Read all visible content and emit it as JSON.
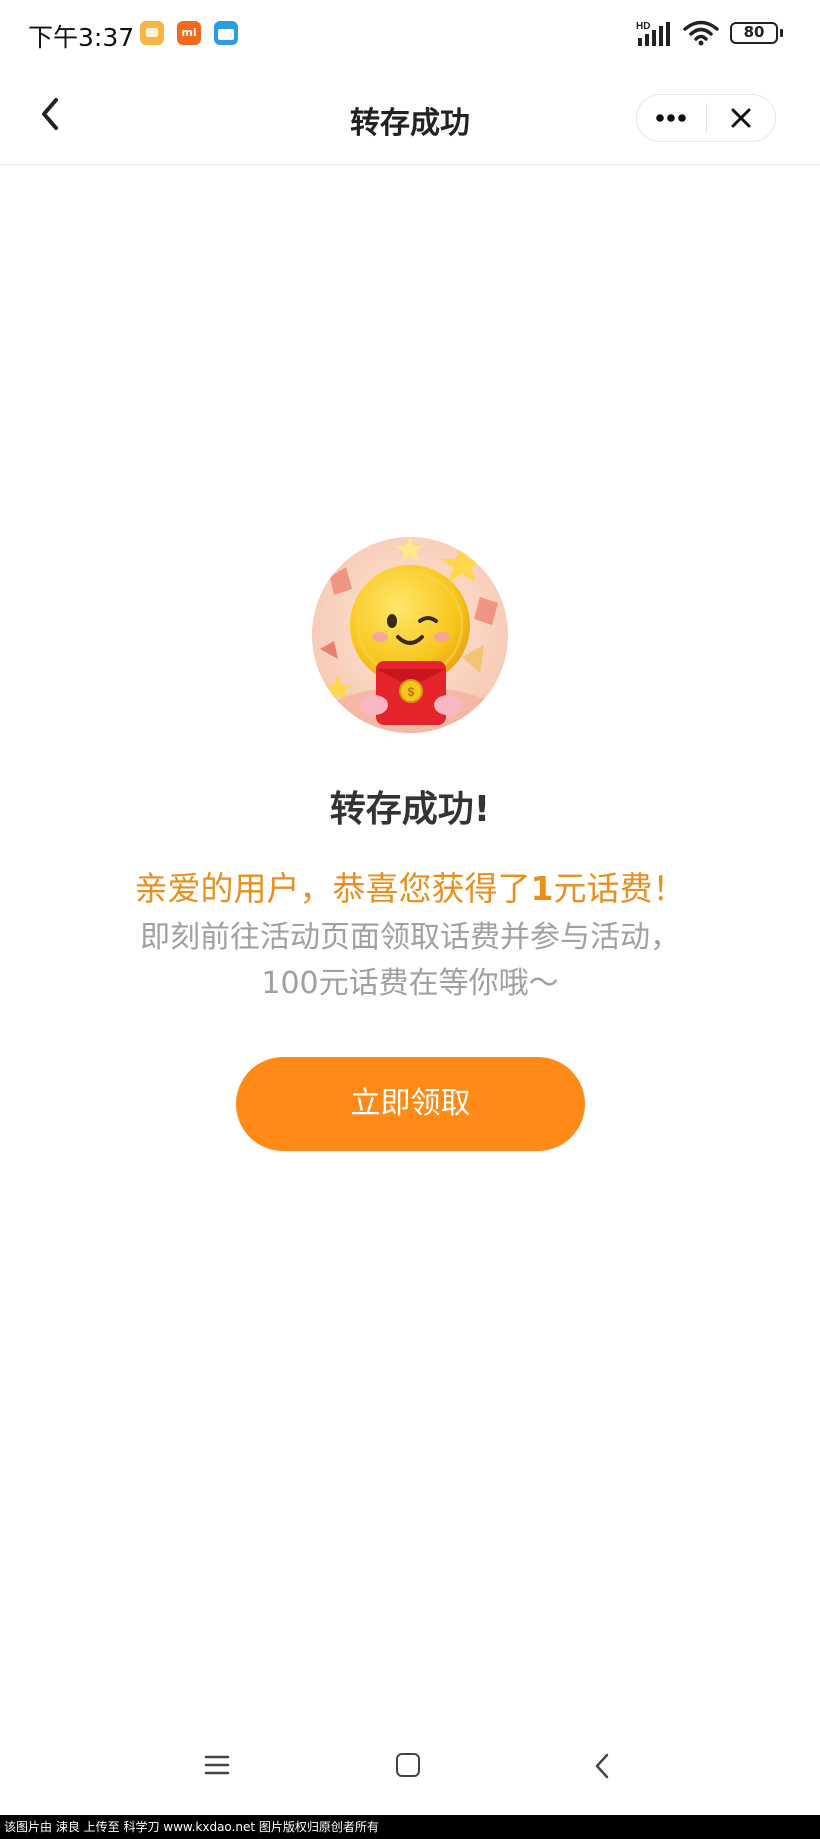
{
  "status_bar": {
    "time": "下午3:37",
    "signal_label": "HD",
    "battery": "80"
  },
  "navbar": {
    "title": "转存成功",
    "back_icon": "chevron-left-icon",
    "more_icon": "more-dots-icon",
    "close_icon": "close-icon"
  },
  "main": {
    "success_title": "转存成功!",
    "promo_prefix": "亲爱的用户，恭喜您获得了",
    "promo_amount": "1",
    "promo_suffix": "元话费！",
    "desc_line1": "即刻前往活动页面领取话费并参与活动，",
    "desc_line2": "100元话费在等你哦～",
    "claim_button": "立即领取"
  },
  "system_nav": {
    "menu_icon": "menu-icon",
    "home_icon": "home-square-icon",
    "back_icon": "back-arrow-icon"
  },
  "watermark": "该图片由 涑良 上传至 科学刀 www.kxdao.net 图片版权归原创者所有",
  "colors": {
    "accent": "#ff8a17",
    "promo": "#e8901e",
    "muted": "#a0a0a0"
  }
}
